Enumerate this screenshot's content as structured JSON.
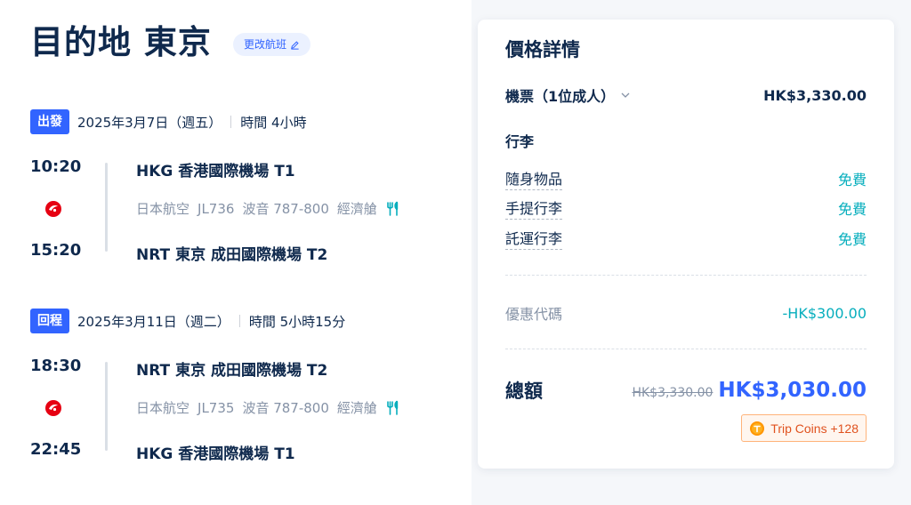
{
  "header": {
    "title": "目的地 東京",
    "change_flight": "更改航班"
  },
  "outbound": {
    "badge": "出發",
    "date": "2025年3月7日（週五）",
    "duration": "時間 4小時",
    "depart_time": "10:20",
    "depart_airport": "HKG 香港國際機場 T1",
    "airline": "日本航空",
    "flight_no": "JL736",
    "aircraft": "波音 787-800",
    "cabin": "經濟艙",
    "arrive_time": "15:20",
    "arrive_airport": "NRT 東京 成田國際機場 T2"
  },
  "return": {
    "badge": "回程",
    "date": "2025年3月11日（週二）",
    "duration": "時間 5小時15分",
    "depart_time": "18:30",
    "depart_airport": "NRT 東京 成田國際機場 T2",
    "airline": "日本航空",
    "flight_no": "JL735",
    "aircraft": "波音 787-800",
    "cabin": "經濟艙",
    "arrive_time": "22:45",
    "arrive_airport": "HKG 香港國際機場 T1"
  },
  "price_details": {
    "title": "價格詳情",
    "ticket_label": "機票（1位成人）",
    "ticket_price": "HK$3,330.00",
    "baggage_title": "行李",
    "baggage": [
      {
        "label": "隨身物品",
        "value": "免費"
      },
      {
        "label": "手提行李",
        "value": "免費"
      },
      {
        "label": "託運行李",
        "value": "免費"
      }
    ],
    "promo_label": "優惠代碼",
    "promo_value": "-HK$300.00",
    "total_label": "總額",
    "original_total": "HK$3,330.00",
    "total": "HK$3,030.00",
    "trip_coins": "Trip Coins +128"
  },
  "colors": {
    "accent": "#3264ff",
    "free": "#06aebd",
    "airline_red": "#e60012",
    "coins_orange": "#e0521f"
  },
  "icons": {
    "edit": "pencil-icon",
    "airline_logo": "jal-logo-icon",
    "meal": "meal-icon",
    "chevron": "chevron-down-icon",
    "coin": "trip-coin-icon"
  }
}
